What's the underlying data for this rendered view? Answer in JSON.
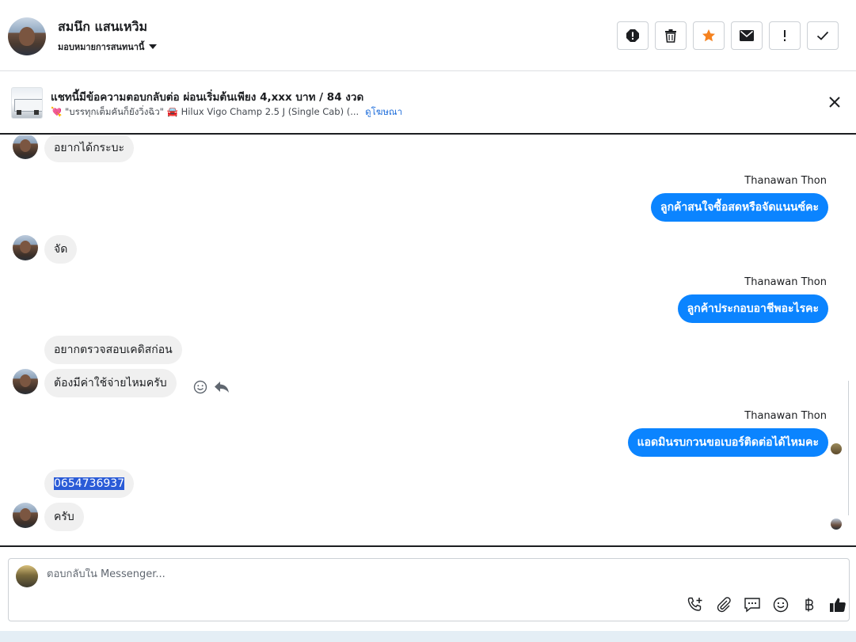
{
  "header": {
    "contact_name": "สมนึก แสนเหวิม",
    "assign_label": "มอบหมายการสนทนานี้",
    "actions": [
      "spam-icon",
      "trash-icon",
      "star-icon",
      "mail-icon",
      "exclamation-icon",
      "check-icon"
    ],
    "star_color": "#f5821f"
  },
  "ad": {
    "title": "แชทนี้มีข้อความตอบกลับต่อ ผ่อนเริ่มต้นเพียง 4,xxx บาท / 84 งวด",
    "subtitle": "💘 \"บรรทุกเต็มคันก็ยังวิ่งฉิว\" 🚘 Hilux Vigo Champ 2.5 J (Single Cab) (...",
    "link": "ดูโฆษณา"
  },
  "messages": {
    "m1": "อยากได้กระบะ",
    "s1": "Thanawan Thon",
    "m2": "ลูกค้าสนใจซื้อสดหรือจัดแนนซ์คะ",
    "m3": "จัด",
    "s2": "Thanawan Thon",
    "m4": "ลูกค้าประกอบอาชีพอะไรคะ",
    "m5": "อยากตรวจสอบเคดิสก่อน",
    "m6": "ต้องมีค่าใช้จ่ายไหมครับ",
    "s3": "Thanawan Thon",
    "m7": "แอดมินรบกวนขอเบอร์ติดต่อได้ไหมคะ",
    "m8": "0654736937",
    "m9": "ครับ"
  },
  "composer": {
    "placeholder": "ตอบกลับใน Messenger...",
    "tools": [
      "call-add-icon",
      "attach-icon",
      "saved-reply-icon",
      "emoji-icon",
      "baht-icon",
      "like-icon"
    ]
  },
  "colors": {
    "outgoing_bubble": "#0b84ff",
    "incoming_bubble": "#f0f0f0",
    "link": "#216fdb"
  }
}
